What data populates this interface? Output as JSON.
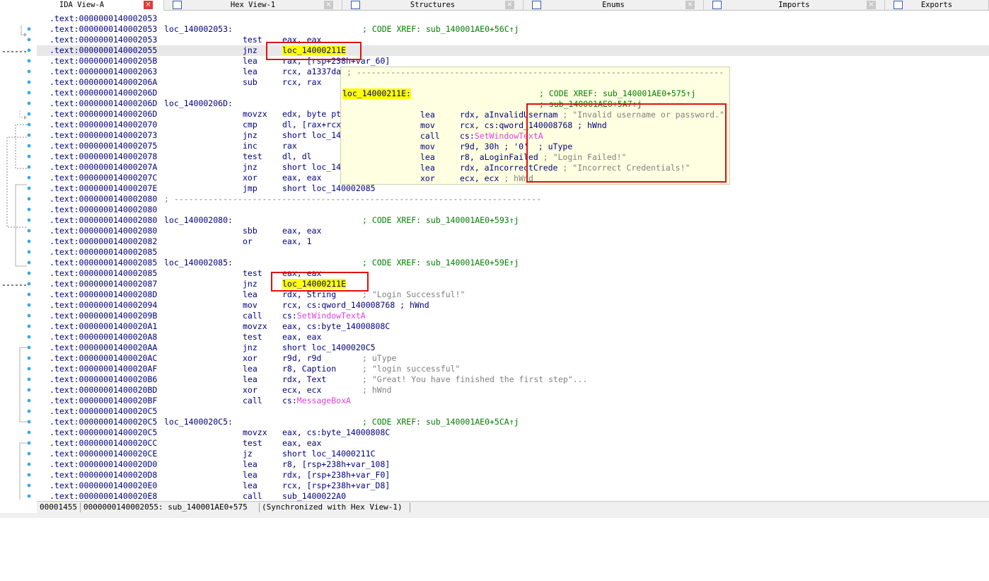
{
  "tabs": [
    {
      "label": "IDA View-A",
      "icon": "ida-view-icon",
      "active": true
    },
    {
      "label": "Hex View-1",
      "icon": "hex-view-icon",
      "active": false
    },
    {
      "label": "Structures",
      "icon": "structures-icon",
      "active": false
    },
    {
      "label": "Enums",
      "icon": "enums-icon",
      "active": false
    },
    {
      "label": "Imports",
      "icon": "imports-icon",
      "active": false
    },
    {
      "label": "Exports",
      "icon": "exports-icon",
      "active": false
    }
  ],
  "close_glyph": "×",
  "listing": [
    {
      "addr": ".text:0000000140002053"
    },
    {
      "addr": ".text:0000000140002053",
      "label": "loc_140002053:",
      "xref": "; CODE XREF: sub_140001AE0+56C↑j"
    },
    {
      "addr": ".text:0000000140002053",
      "mn": "test",
      "op": "eax, eax"
    },
    {
      "addr": ".text:0000000140002055",
      "mn": "jnz",
      "op": "loc_14000211E",
      "current": true
    },
    {
      "addr": ".text:000000014000205B",
      "mn": "lea",
      "op": "rax, [rsp+238h+var_60]"
    },
    {
      "addr": ".text:0000000140002063",
      "mn": "lea",
      "op": "rcx, a1337da"
    },
    {
      "addr": ".text:000000014000206A",
      "mn": "sub",
      "op": "rcx, rax"
    },
    {
      "addr": ".text:000000014000206D"
    },
    {
      "addr": ".text:000000014000206D",
      "label": "loc_14000206D:"
    },
    {
      "addr": ".text:000000014000206D",
      "mn": "movzx",
      "op": "edx, byte pt"
    },
    {
      "addr": ".text:0000000140002070",
      "mn": "cmp",
      "op": "dl, [rax+rcx"
    },
    {
      "addr": ".text:0000000140002073",
      "mn": "jnz",
      "op": "short loc_14"
    },
    {
      "addr": ".text:0000000140002075",
      "mn": "inc",
      "op": "rax"
    },
    {
      "addr": ".text:0000000140002078",
      "mn": "test",
      "op": "dl, dl"
    },
    {
      "addr": ".text:000000014000207A",
      "mn": "jnz",
      "op": "short loc_14"
    },
    {
      "addr": ".text:000000014000207C",
      "mn": "xor",
      "op": "eax, eax"
    },
    {
      "addr": ".text:000000014000207E",
      "mn": "jmp",
      "op": "short loc_140002085"
    },
    {
      "addr": ".text:0000000140002080",
      "sep": "; ---------------------------------------------------------------------------"
    },
    {
      "addr": ".text:0000000140002080"
    },
    {
      "addr": ".text:0000000140002080",
      "label": "loc_140002080:",
      "xref": "; CODE XREF: sub_140001AE0+593↑j"
    },
    {
      "addr": ".text:0000000140002080",
      "mn": "sbb",
      "op": "eax, eax"
    },
    {
      "addr": ".text:0000000140002082",
      "mn": "or",
      "op": "eax, 1"
    },
    {
      "addr": ".text:0000000140002085"
    },
    {
      "addr": ".text:0000000140002085",
      "label": "loc_140002085:",
      "xref": "; CODE XREF: sub_140001AE0+59E↑j"
    },
    {
      "addr": ".text:0000000140002085",
      "mn": "test",
      "op": "eax, eax"
    },
    {
      "addr": ".text:0000000140002087",
      "mn": "jnz",
      "op": "loc_14000211E"
    },
    {
      "addr": ".text:000000014000208D",
      "mn": "lea",
      "op": "rdx, String",
      "cm": "; \"Login Successful!\""
    },
    {
      "addr": ".text:0000000140002094",
      "mn": "mov",
      "op": "rcx, cs:qword_140008768 ; hWnd"
    },
    {
      "addr": ".text:000000014000209B",
      "mn": "call",
      "op": "cs:",
      "api": "SetWindowTextA"
    },
    {
      "addr": ".text:00000001400020A1",
      "mn": "movzx",
      "op": "eax, cs:byte_14000808C"
    },
    {
      "addr": ".text:00000001400020A8",
      "mn": "test",
      "op": "eax, eax"
    },
    {
      "addr": ".text:00000001400020AA",
      "mn": "jnz",
      "op": "short loc_1400020C5"
    },
    {
      "addr": ".text:00000001400020AC",
      "mn": "xor",
      "op": "r9d, r9d",
      "cm": "; uType"
    },
    {
      "addr": ".text:00000001400020AF",
      "mn": "lea",
      "op": "r8, Caption",
      "cm": "; \"login successful\""
    },
    {
      "addr": ".text:00000001400020B6",
      "mn": "lea",
      "op": "rdx, Text",
      "cm": "; \"Great! You have finished the first step\"..."
    },
    {
      "addr": ".text:00000001400020BD",
      "mn": "xor",
      "op": "ecx, ecx",
      "cm": "; hWnd"
    },
    {
      "addr": ".text:00000001400020BF",
      "mn": "call",
      "op": "cs:",
      "api": "MessageBoxA"
    },
    {
      "addr": ".text:00000001400020C5"
    },
    {
      "addr": ".text:00000001400020C5",
      "label": "loc_1400020C5:",
      "xref": "; CODE XREF: sub_140001AE0+5CA↑j"
    },
    {
      "addr": ".text:00000001400020C5",
      "mn": "movzx",
      "op": "eax, cs:byte_14000808C"
    },
    {
      "addr": ".text:00000001400020CC",
      "mn": "test",
      "op": "eax, eax"
    },
    {
      "addr": ".text:00000001400020CE",
      "mn": "jz",
      "op": "short loc_14000211C"
    },
    {
      "addr": ".text:00000001400020D0",
      "mn": "lea",
      "op": "r8, [rsp+238h+var_108]"
    },
    {
      "addr": ".text:00000001400020D8",
      "mn": "lea",
      "op": "rdx, [rsp+238h+var_F0]"
    },
    {
      "addr": ".text:00000001400020E0",
      "mn": "lea",
      "op": "rcx, [rsp+238h+var_D8]"
    },
    {
      "addr": ".text:00000001400020E8",
      "mn": "call",
      "op": "sub_1400022A0"
    }
  ],
  "popup": [
    {
      "sep": "; ---------------------------------------------------------------------------"
    },
    {},
    {
      "label": "loc_14000211E:",
      "xref": "; CODE XREF: sub_140001AE0+575↑j"
    },
    {
      "xref": "; sub_140001AE0+5A7↑j"
    },
    {
      "mn": "lea",
      "op": "rdx, aInvalidUsernam",
      "cm": "; \"Invalid username or password.\""
    },
    {
      "mn": "mov",
      "op": "rcx, cs:qword_140008768 ; hWnd"
    },
    {
      "mn": "call",
      "op": "cs:",
      "api": "SetWindowTextA"
    },
    {
      "mn": "mov",
      "op": "r9d, 30h ; '0'  ; uType"
    },
    {
      "mn": "lea",
      "op": "r8, aLoginFailed",
      "cm": "; \"Login Failed!\""
    },
    {
      "mn": "lea",
      "op": "rdx, aIncorrectCrede",
      "cm": "; \"Incorrect Credentials!\""
    },
    {
      "mn": "xor",
      "op": "ecx, ecx",
      "cm": "; hWnd"
    }
  ],
  "status": {
    "offset": "00001455",
    "location": "0000000140002055: sub_140001AE0+575",
    "sync": "(Synchronized with Hex View-1)"
  },
  "colors": {
    "code": "#000080",
    "xref": "#008000",
    "comment": "#808080",
    "api": "#e040e0",
    "highlight": "#ffff00",
    "annotation_box": "#e01010",
    "hint_background": "#ffffe1"
  }
}
